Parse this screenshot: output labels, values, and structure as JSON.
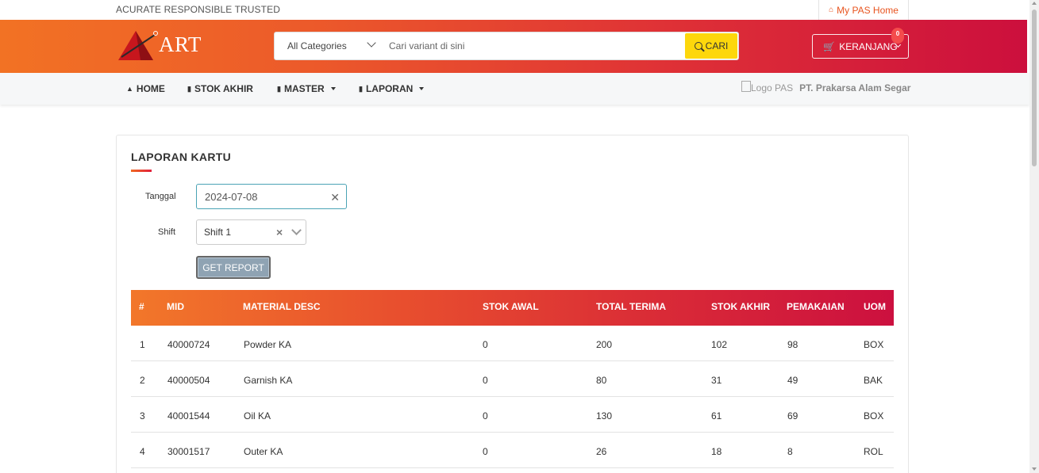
{
  "topbar": {
    "tagline": "ACURATE RESPONSIBLE TRUSTED",
    "my_pas_home": "My PAS Home",
    "home_icon": "house-icon"
  },
  "header": {
    "logo_text": "ART",
    "category_select": "All Categories",
    "search_placeholder": "Cari variant di sini",
    "search_button": "CARI",
    "cart_label": "KERANJANG",
    "cart_count": "0",
    "colors": {
      "brand_start": "#f27224",
      "brand_end": "#cc0f3d",
      "search_button": "#fdd70c"
    }
  },
  "nav": {
    "items": [
      {
        "label": "HOME",
        "icon": "graduation-cap-icon"
      },
      {
        "label": "STOK AKHIR",
        "icon": "book-icon"
      },
      {
        "label": "MASTER",
        "icon": "book-icon",
        "dropdown": true
      },
      {
        "label": "LAPORAN",
        "icon": "book-icon",
        "dropdown": true
      }
    ],
    "logo_alt": "Logo PAS",
    "company": "PT. Prakarsa Alam Segar"
  },
  "card": {
    "title": "LAPORAN KARTU",
    "tanggal_label": "Tanggal",
    "tanggal_value": "2024-07-08",
    "shift_label": "Shift",
    "shift_value": "Shift 1",
    "button": "GET REPORT"
  },
  "table": {
    "headers": [
      "#",
      "MID",
      "MATERIAL DESC",
      "STOK AWAL",
      "TOTAL TERIMA",
      "STOK AKHIR",
      "PEMAKAIAN",
      "UOM"
    ],
    "rows": [
      [
        "1",
        "40000724",
        "Powder KA",
        "0",
        "200",
        "102",
        "98",
        "BOX"
      ],
      [
        "2",
        "40000504",
        "Garnish KA",
        "0",
        "80",
        "31",
        "49",
        "BAK"
      ],
      [
        "3",
        "40001544",
        "Oil KA",
        "0",
        "130",
        "61",
        "69",
        "BOX"
      ],
      [
        "4",
        "30001517",
        "Outer KA",
        "0",
        "26",
        "18",
        "8",
        "ROL"
      ]
    ]
  }
}
